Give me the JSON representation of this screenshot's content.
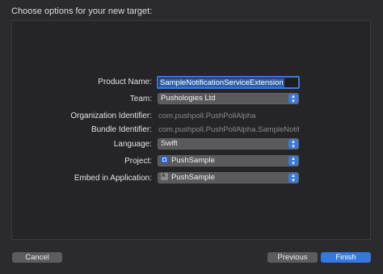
{
  "dialog": {
    "heading": "Choose options for your new target:"
  },
  "form": {
    "product_name": {
      "label": "Product Name:",
      "value": "SampleNotificationServiceExtension"
    },
    "team": {
      "label": "Team:",
      "value": "Pushologies Ltd"
    },
    "organization_identifier": {
      "label": "Organization Identifier:",
      "value": "com.pushpoll.PushPollAlpha"
    },
    "bundle_identifier": {
      "label": "Bundle Identifier:",
      "value": "com.pushpoll.PushPollAlpha.SampleNotific..."
    },
    "language": {
      "label": "Language:",
      "value": "Swift"
    },
    "project": {
      "label": "Project:",
      "value": "PushSample",
      "icon": "xcode-project-icon"
    },
    "embed_in_application": {
      "label": "Embed in Application:",
      "value": "PushSample",
      "icon": "app-target-icon"
    }
  },
  "buttons": {
    "cancel": "Cancel",
    "previous": "Previous",
    "finish": "Finish"
  },
  "colors": {
    "accent": "#3478e0",
    "background": "#2b2b2d",
    "panel": "#252527"
  }
}
